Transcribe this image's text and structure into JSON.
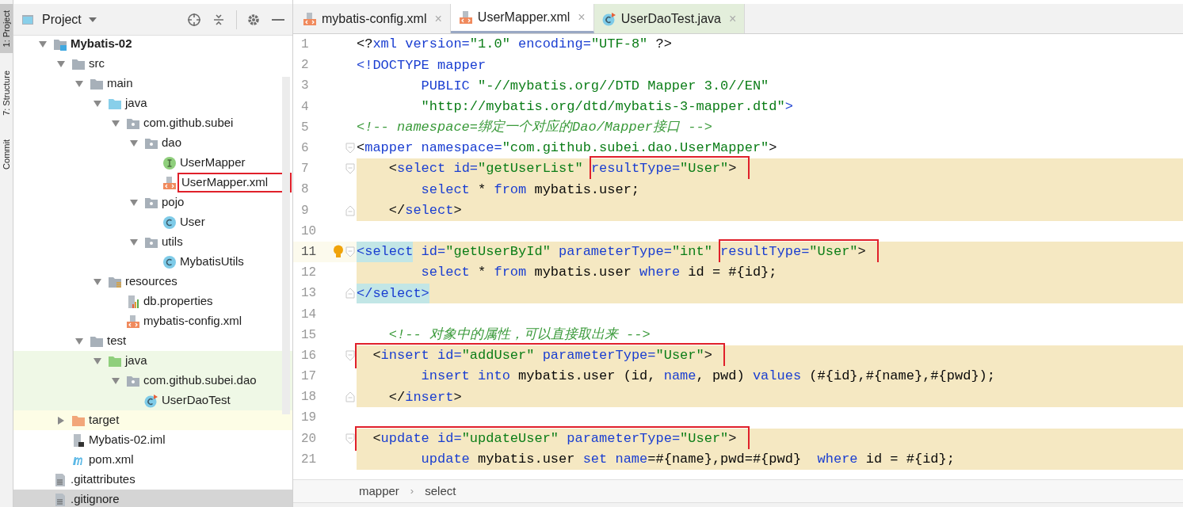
{
  "tool_strip": [
    {
      "label": "1: Project",
      "selected": true
    },
    {
      "label": "7: Structure",
      "selected": false
    },
    {
      "label": "Commit",
      "selected": false
    }
  ],
  "project_panel": {
    "title": "Project",
    "tree": [
      {
        "label": "Mybatis-02",
        "kind": "module",
        "expanded": true,
        "selected": false,
        "children": [
          {
            "label": "src",
            "kind": "folder",
            "expanded": true,
            "selected": false,
            "children": [
              {
                "label": "main",
                "kind": "folder",
                "expanded": true,
                "selected": false,
                "children": [
                  {
                    "label": "java",
                    "kind": "source-folder",
                    "expanded": true,
                    "selected": false,
                    "children": [
                      {
                        "label": "com.github.subei",
                        "kind": "package",
                        "expanded": true,
                        "selected": false,
                        "children": [
                          {
                            "label": "dao",
                            "kind": "package",
                            "expanded": true,
                            "selected": false,
                            "children": [
                              {
                                "label": "UserMapper",
                                "kind": "interface",
                                "selected": false
                              },
                              {
                                "label": "UserMapper.xml",
                                "kind": "xml",
                                "selected": false,
                                "boxed": true
                              }
                            ]
                          },
                          {
                            "label": "pojo",
                            "kind": "package",
                            "expanded": true,
                            "selected": false,
                            "children": [
                              {
                                "label": "User",
                                "kind": "class",
                                "selected": false
                              }
                            ]
                          },
                          {
                            "label": "utils",
                            "kind": "package",
                            "expanded": true,
                            "selected": false,
                            "children": [
                              {
                                "label": "MybatisUtils",
                                "kind": "class",
                                "selected": false
                              }
                            ]
                          }
                        ]
                      }
                    ]
                  },
                  {
                    "label": "resources",
                    "kind": "resources",
                    "expanded": true,
                    "selected": false,
                    "children": [
                      {
                        "label": "db.properties",
                        "kind": "properties",
                        "selected": false
                      },
                      {
                        "label": "mybatis-config.xml",
                        "kind": "xml",
                        "selected": false
                      }
                    ]
                  }
                ]
              },
              {
                "label": "test",
                "kind": "folder",
                "expanded": true,
                "selected": false,
                "children": [
                  {
                    "label": "java",
                    "kind": "test-folder",
                    "expanded": true,
                    "selected": false,
                    "in_test": true,
                    "children": [
                      {
                        "label": "com.github.subei.dao",
                        "kind": "package",
                        "expanded": true,
                        "selected": false,
                        "in_test": true,
                        "children": [
                          {
                            "label": "UserDaoTest",
                            "kind": "test-class",
                            "selected": false,
                            "in_test": true
                          }
                        ]
                      }
                    ]
                  }
                ]
              }
            ]
          },
          {
            "label": "target",
            "kind": "excluded-folder",
            "expanded": false,
            "selected": false
          },
          {
            "label": "Mybatis-02.iml",
            "kind": "iml",
            "selected": false
          },
          {
            "label": "pom.xml",
            "kind": "maven",
            "selected": false
          }
        ]
      },
      {
        "label": ".gitattributes",
        "kind": "text-file",
        "selected": false
      },
      {
        "label": ".gitignore",
        "kind": "text-file",
        "selected": true
      }
    ]
  },
  "editor": {
    "tabs": [
      {
        "label": "mybatis-config.xml",
        "kind": "xml",
        "selected": false,
        "in_test": false,
        "close": "×"
      },
      {
        "label": "UserMapper.xml",
        "kind": "xml",
        "selected": true,
        "in_test": false,
        "close": "×"
      },
      {
        "label": "UserDaoTest.java",
        "kind": "test-class",
        "selected": false,
        "in_test": true,
        "close": "×"
      }
    ],
    "lines": [
      {
        "number": "1",
        "highlight": false,
        "current": false,
        "tokens": [
          {
            "text": "<?",
            "kind": "plain"
          },
          {
            "text": "xml version=",
            "kind": "tag"
          },
          {
            "text": "\"1.0\"",
            "kind": "value"
          },
          {
            "text": " encoding=",
            "kind": "tag"
          },
          {
            "text": "\"UTF-8\"",
            "kind": "value"
          },
          {
            "text": " ?>",
            "kind": "plain"
          }
        ]
      },
      {
        "number": "2",
        "highlight": false,
        "current": false,
        "tokens": [
          {
            "text": "<!DOCTYPE mapper",
            "kind": "tag"
          }
        ]
      },
      {
        "number": "3",
        "highlight": false,
        "current": false,
        "tokens": [
          {
            "text": "        PUBLIC ",
            "kind": "tag"
          },
          {
            "text": "\"-//mybatis.org//DTD Mapper 3.0//EN\"",
            "kind": "value"
          }
        ]
      },
      {
        "number": "4",
        "highlight": false,
        "current": false,
        "tokens": [
          {
            "text": "        \"http://mybatis.org/dtd/mybatis-3-mapper.dtd\"",
            "kind": "value"
          },
          {
            "text": ">",
            "kind": "tag"
          }
        ]
      },
      {
        "number": "5",
        "highlight": false,
        "current": false,
        "tokens": [
          {
            "text": "<!-- namespace=绑定一个对应的Dao/Mapper接口 -->",
            "kind": "comment"
          }
        ]
      },
      {
        "number": "6",
        "highlight": false,
        "current": false,
        "fold_start": true,
        "tokens": [
          {
            "text": "<",
            "kind": "plain"
          },
          {
            "text": "mapper namespace=",
            "kind": "tag"
          },
          {
            "text": "\"com.github.subei.dao.UserMapper\"",
            "kind": "value"
          },
          {
            "text": ">",
            "kind": "plain"
          }
        ]
      },
      {
        "number": "7",
        "highlight": true,
        "current": false,
        "fold_start": true,
        "tokens": [
          {
            "text": "    <",
            "kind": "plain"
          },
          {
            "text": "select id=",
            "kind": "tag"
          },
          {
            "text": "\"getUserList\" ",
            "kind": "value"
          }
        ],
        "boxed_tokens": [
          {
            "text": "resultType=",
            "kind": "tag"
          },
          {
            "text": "\"User\"",
            "kind": "value"
          },
          {
            "text": ">",
            "kind": "plain"
          }
        ]
      },
      {
        "number": "8",
        "highlight": true,
        "current": false,
        "tokens": [
          {
            "text": "        select ",
            "kind": "keyword"
          },
          {
            "text": "* ",
            "kind": "plain"
          },
          {
            "text": "from ",
            "kind": "keyword"
          },
          {
            "text": "mybatis.user;",
            "kind": "plain"
          }
        ]
      },
      {
        "number": "9",
        "highlight": true,
        "current": false,
        "fold_end": true,
        "tokens": [
          {
            "text": "    </",
            "kind": "plain"
          },
          {
            "text": "select",
            "kind": "tag"
          },
          {
            "text": ">",
            "kind": "plain"
          }
        ]
      },
      {
        "number": "10",
        "highlight": false,
        "current": false
      },
      {
        "number": "11",
        "highlight": true,
        "current": true,
        "fold_start": true,
        "tokens": [
          {
            "text": "    <select",
            "kind": "tag",
            "matched": true
          },
          {
            "text": " id=",
            "kind": "tag"
          },
          {
            "text": "\"getUserById\" ",
            "kind": "value"
          },
          {
            "text": "parameterType=",
            "kind": "tag"
          },
          {
            "text": "\"int\" ",
            "kind": "value"
          }
        ],
        "boxed_tokens": [
          {
            "text": "resultType=",
            "kind": "tag"
          },
          {
            "text": "\"User\"",
            "kind": "value"
          },
          {
            "text": ">",
            "kind": "plain"
          }
        ]
      },
      {
        "number": "12",
        "highlight": true,
        "current": false,
        "tokens": [
          {
            "text": "        select ",
            "kind": "keyword"
          },
          {
            "text": "* ",
            "kind": "plain"
          },
          {
            "text": "from ",
            "kind": "keyword"
          },
          {
            "text": "mybatis.user ",
            "kind": "plain"
          },
          {
            "text": "where ",
            "kind": "keyword"
          },
          {
            "text": "id = #{id};",
            "kind": "plain"
          }
        ]
      },
      {
        "number": "13",
        "highlight": true,
        "current": false,
        "fold_end": true,
        "tokens": [
          {
            "text": "    </select>",
            "kind": "tag",
            "matched": true
          }
        ]
      },
      {
        "number": "14",
        "highlight": false,
        "current": false
      },
      {
        "number": "15",
        "highlight": false,
        "current": false,
        "tokens": [
          {
            "text": "    <!-- 对象中的属性，可以直接取出来 -->",
            "kind": "comment"
          }
        ]
      },
      {
        "number": "16",
        "highlight": true,
        "current": false,
        "fold_start": true,
        "boxed_tokens": [
          {
            "text": "    <",
            "kind": "plain"
          },
          {
            "text": "insert id=",
            "kind": "tag"
          },
          {
            "text": "\"addUser\" ",
            "kind": "value"
          },
          {
            "text": "parameterType=",
            "kind": "tag"
          },
          {
            "text": "\"User\"",
            "kind": "value"
          },
          {
            "text": ">",
            "kind": "plain"
          }
        ]
      },
      {
        "number": "17",
        "highlight": true,
        "current": false,
        "tokens": [
          {
            "text": "        insert into ",
            "kind": "keyword"
          },
          {
            "text": "mybatis.user (id, ",
            "kind": "plain"
          },
          {
            "text": "name",
            "kind": "keyword"
          },
          {
            "text": ", pwd) ",
            "kind": "plain"
          },
          {
            "text": "values ",
            "kind": "keyword"
          },
          {
            "text": "(#{id},#{name},#{pwd});",
            "kind": "plain"
          }
        ]
      },
      {
        "number": "18",
        "highlight": true,
        "current": false,
        "fold_end": true,
        "tokens": [
          {
            "text": "    </",
            "kind": "plain"
          },
          {
            "text": "insert",
            "kind": "tag"
          },
          {
            "text": ">",
            "kind": "plain"
          }
        ]
      },
      {
        "number": "19",
        "highlight": false,
        "current": false
      },
      {
        "number": "20",
        "highlight": true,
        "current": false,
        "fold_start": true,
        "boxed_tokens": [
          {
            "text": "     <",
            "kind": "plain"
          },
          {
            "text": "update id=",
            "kind": "tag"
          },
          {
            "text": "\"updateUser\" ",
            "kind": "value"
          },
          {
            "text": "parameterType=",
            "kind": "tag"
          },
          {
            "text": "\"User\"",
            "kind": "value"
          },
          {
            "text": ">",
            "kind": "plain"
          }
        ]
      },
      {
        "number": "21",
        "highlight": true,
        "current": false,
        "tokens": [
          {
            "text": "        update ",
            "kind": "keyword"
          },
          {
            "text": "mybatis.user ",
            "kind": "plain"
          },
          {
            "text": "set name",
            "kind": "keyword"
          },
          {
            "text": "=#{name},pwd=#{pwd}  ",
            "kind": "plain"
          },
          {
            "text": "where ",
            "kind": "keyword"
          },
          {
            "text": "id = #{id};",
            "kind": "plain"
          }
        ]
      }
    ],
    "breadcrumb": {
      "items": [
        "mapper",
        "select"
      ],
      "separator": "›"
    }
  }
}
